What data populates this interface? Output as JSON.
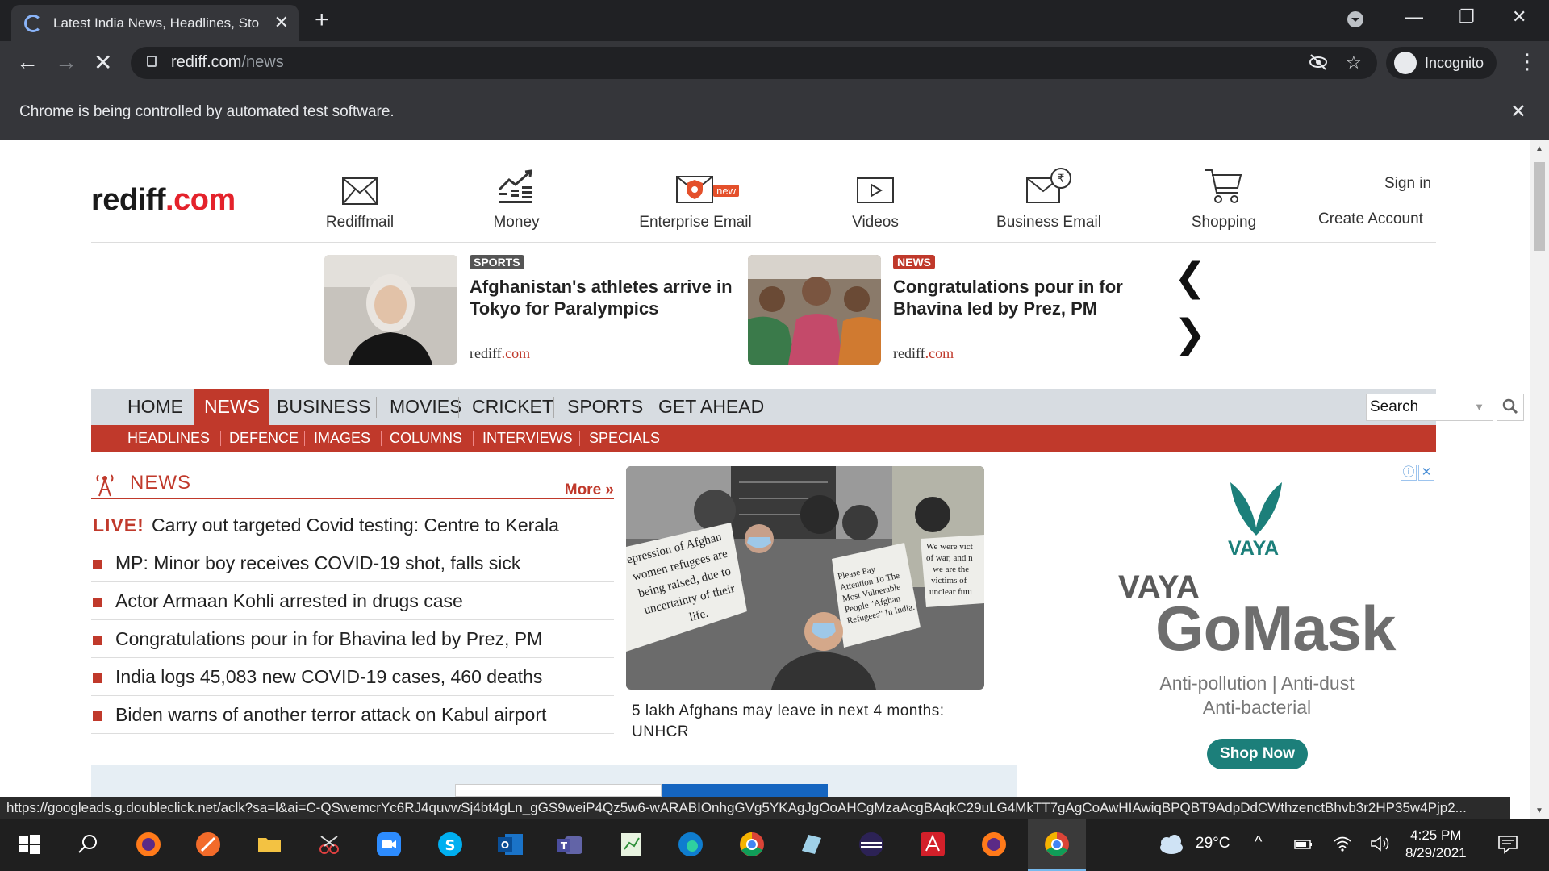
{
  "browser": {
    "tab_title": "Latest India News, Headlines, Sto",
    "url_host": "rediff.com",
    "url_path": "/news",
    "profile_label": "Incognito",
    "infobar_message": "Chrome is being controlled by automated test software."
  },
  "header": {
    "logo_main": "rediff",
    "logo_dot": ".",
    "logo_tld": "com",
    "nav": [
      {
        "label": "Rediffmail",
        "icon": "mail-icon"
      },
      {
        "label": "Money",
        "icon": "chart-icon"
      },
      {
        "label": "Enterprise Email",
        "icon": "enterprise-mail-icon",
        "badge": "new"
      },
      {
        "label": "Videos",
        "icon": "video-icon"
      },
      {
        "label": "Business Email",
        "icon": "business-mail-icon"
      },
      {
        "label": "Shopping",
        "icon": "cart-icon"
      }
    ],
    "sign_in": "Sign in",
    "create_account": "Create Account"
  },
  "carousel": [
    {
      "tag": "SPORTS",
      "tag_color": "#555555",
      "headline": "Afghanistan's athletes arrive in Tokyo for Paralympics",
      "source_main": "rediff",
      "source_tld": ".com"
    },
    {
      "tag": "NEWS",
      "tag_color": "#c0392b",
      "headline": "Congratulations pour in for Bhavina led by Prez, PM",
      "source_main": "rediff",
      "source_tld": ".com"
    }
  ],
  "main_nav": [
    "HOME",
    "NEWS",
    "BUSINESS",
    "MOVIES",
    "CRICKET",
    "SPORTS",
    "GET AHEAD"
  ],
  "main_nav_active": "NEWS",
  "search_placeholder": "Search",
  "sub_nav": [
    "HEADLINES",
    "DEFENCE",
    "IMAGES",
    "COLUMNS",
    "INTERVIEWS",
    "SPECIALS"
  ],
  "news": {
    "title": "NEWS",
    "more": "More »",
    "live_label": "LIVE!",
    "items": [
      "Carry out targeted Covid testing: Centre to Kerala",
      "MP: Minor boy receives COVID-19 shot, falls sick",
      "Actor Armaan Kohli arrested in drugs case",
      "Congratulations pour in for Bhavina led by Prez, PM",
      "India logs 45,083 new COVID-19 cases, 460 deaths",
      "Biden warns of another terror attack on Kabul airport"
    ]
  },
  "feature": {
    "caption": "5 lakh Afghans may leave in next 4 months: UNHCR",
    "placard_text": "epression of Afghan women refugees are being raised, due to uncertainty of their life."
  },
  "ad": {
    "brand": "VAYA",
    "brand_big": "VAYA",
    "product": "GoMask",
    "line1": "Anti-pollution | Anti-dust",
    "line2": "Anti-bacterial",
    "cta": "Shop Now"
  },
  "status_url": "https://googleads.g.doubleclick.net/aclk?sa=l&ai=C-QSwemcrYc6RJ4quvwSj4bt4gLn_gGS9weiP4Qz5w6-wARABIOnhgGVg5YKAgJgOoAHCgMzaAcgBAqkC29uLG4MkTT7gAgCoAwHIAwiqBPQBT9AdpDdCWthzenctBhvb3r2HP35w4Pjp2...",
  "taskbar": {
    "weather": "29°C",
    "time": "4:25 PM",
    "date": "8/29/2021"
  },
  "colors": {
    "accent": "#c0392b",
    "brand_teal": "#1c7f7a"
  }
}
